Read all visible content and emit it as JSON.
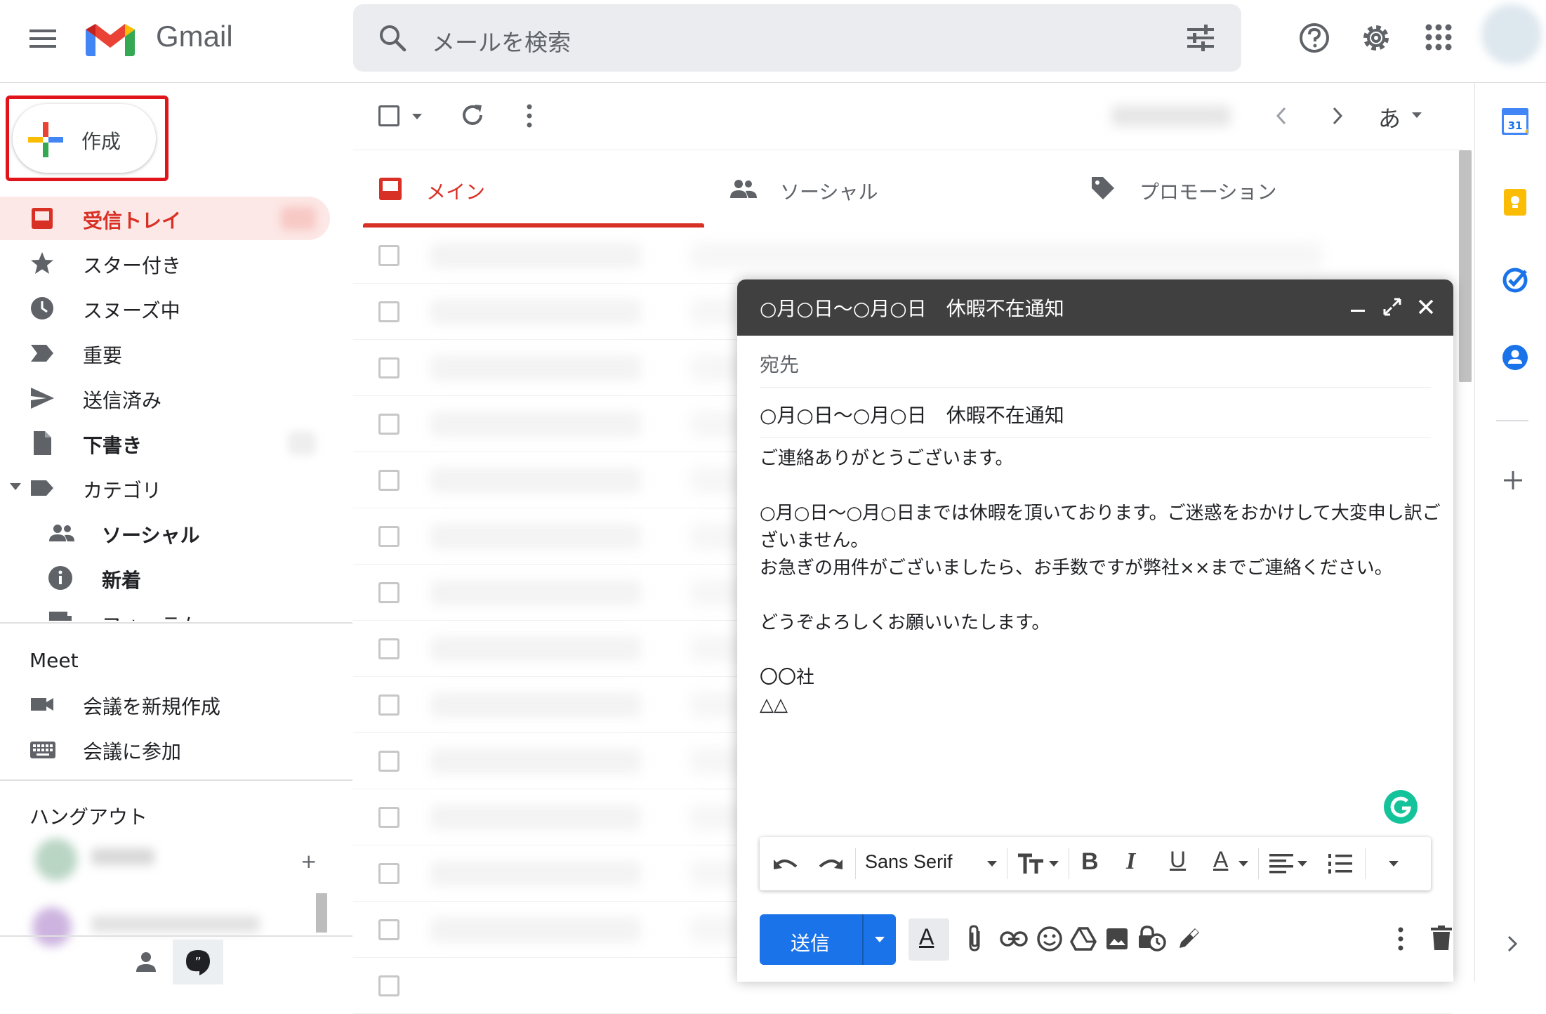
{
  "app": {
    "name": "Gmail",
    "search_placeholder": "メールを検索"
  },
  "compose_button": {
    "label": "作成"
  },
  "sidebar": {
    "items": [
      {
        "label": "受信トレイ",
        "icon": "inbox-icon",
        "active": true
      },
      {
        "label": "スター付き",
        "icon": "star-icon"
      },
      {
        "label": "スヌーズ中",
        "icon": "clock-icon"
      },
      {
        "label": "重要",
        "icon": "important-icon"
      },
      {
        "label": "送信済み",
        "icon": "send-icon"
      },
      {
        "label": "下書き",
        "icon": "draft-icon",
        "bold": true
      },
      {
        "label": "カテゴリ",
        "icon": "label-icon"
      }
    ],
    "categories": [
      {
        "label": "ソーシャル",
        "icon": "people-icon"
      },
      {
        "label": "新着",
        "icon": "info-icon"
      },
      {
        "label": "フォーラム",
        "icon": "forum-icon"
      }
    ],
    "meet": {
      "title": "Meet",
      "items": [
        {
          "label": "会議を新規作成",
          "icon": "video-icon"
        },
        {
          "label": "会議に参加",
          "icon": "keyboard-icon"
        }
      ]
    },
    "hangouts": {
      "title": "ハングアウト"
    }
  },
  "toolbar": {
    "input_tool": "あ"
  },
  "tabs": [
    {
      "label": "メイン",
      "icon": "inbox-icon",
      "active": true
    },
    {
      "label": "ソーシャル",
      "icon": "people-icon"
    },
    {
      "label": "プロモーション",
      "icon": "tag-icon"
    }
  ],
  "compose": {
    "header_title": "○月○日〜○月○日　休暇不在通知",
    "to_placeholder": "宛先",
    "subject": "○月○日〜○月○日　休暇不在通知",
    "body_lines": [
      "ご連絡ありがとうございます。",
      "",
      "○月○日〜○月○日までは休暇を頂いております。ご迷惑をおかけして大変申し訳ご",
      "ざいません。",
      "お急ぎの用件がございましたら、お手数ですが弊社××までご連絡ください。",
      "",
      "どうぞよろしくお願いいたします。",
      "",
      "〇〇社",
      "△△"
    ],
    "font_name": "Sans Serif",
    "send_label": "送信"
  },
  "colors": {
    "accent_red": "#d93025",
    "send_blue": "#1a73e8",
    "compose_header": "#404040",
    "grammarly_green": "#15c39a"
  }
}
